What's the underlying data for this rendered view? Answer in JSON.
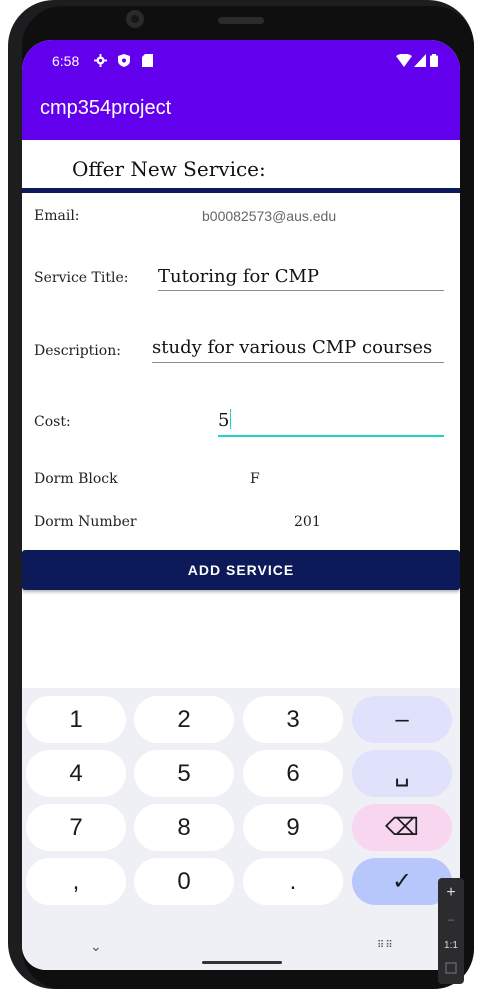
{
  "status_bar": {
    "time": "6:58",
    "left_icons": [
      "gear-icon",
      "shield-icon",
      "sd-card-icon"
    ],
    "right_icons": [
      "wifi-icon",
      "signal-icon",
      "battery-icon"
    ]
  },
  "app_bar": {
    "title": "cmp354project"
  },
  "page": {
    "section_title": "Offer New Service:"
  },
  "form": {
    "email_label": "Email:",
    "email_value": "b00082573@aus.edu",
    "service_title_label": "Service Title:",
    "service_title_value": "Tutoring for CMP",
    "description_label": "Description:",
    "description_value": "study for various CMP courses",
    "cost_label": "Cost:",
    "cost_value": "5",
    "dorm_block_label": "Dorm Block",
    "dorm_block_value": "F",
    "dorm_number_label": "Dorm Number",
    "dorm_number_value": "201",
    "submit_label": "ADD SERVICE"
  },
  "keyboard": {
    "keys": [
      "1",
      "2",
      "3",
      "–",
      "4",
      "5",
      "6",
      "␣",
      "7",
      "8",
      "9",
      "⌫",
      ",",
      "0",
      ".",
      "✓"
    ],
    "chevron": "⌄",
    "grid": "⠿⠿"
  },
  "emulator_zoom": {
    "plus": "+",
    "minus": "–",
    "ratio": "1:1"
  },
  "colors": {
    "primary": "#6200ee",
    "button": "#0d1a5a",
    "accent": "#1fd4c7"
  }
}
